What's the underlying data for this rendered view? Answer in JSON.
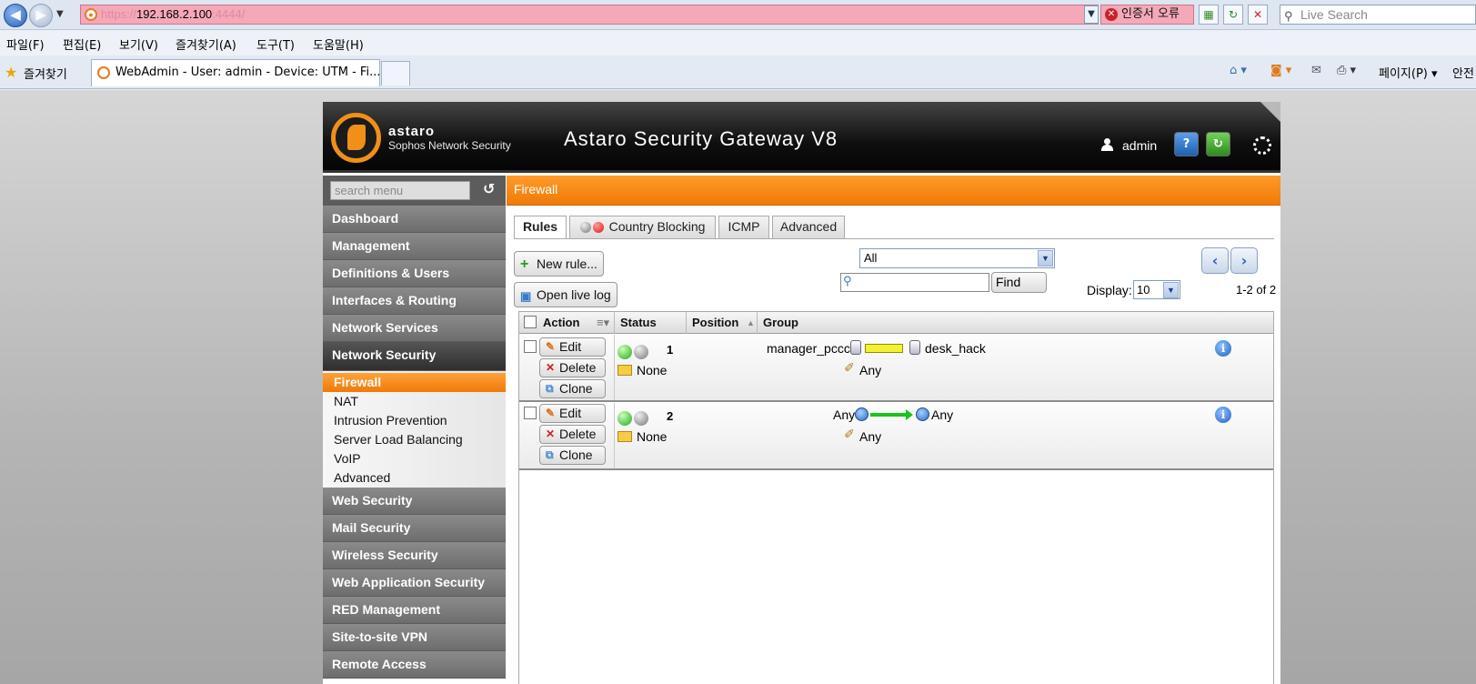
{
  "browser": {
    "url_protocol": "https://",
    "url_host": "192.168.2.100",
    "url_port": ":4444/",
    "cert_error": "인증서 오류",
    "live_search_placeholder": "Live Search",
    "menu": [
      "파일(F)",
      "편집(E)",
      "보기(V)",
      "즐겨찾기(A)",
      "도구(T)",
      "도움말(H)"
    ],
    "favorites_label": "즐겨찾기",
    "tab_title": "WebAdmin - User: admin - Device: UTM - Fi...",
    "page_menu": "페이지(P)",
    "safety_menu": "안전"
  },
  "app": {
    "brand": "astaro",
    "brand_sub": "Sophos Network Security",
    "title": "Astaro Security Gateway V8",
    "user": "admin"
  },
  "sidebar": {
    "search_placeholder": "search menu",
    "sections_top": [
      "Dashboard",
      "Management",
      "Definitions & Users",
      "Interfaces & Routing",
      "Network Services"
    ],
    "active_section": "Network Security",
    "sub_items": [
      "Firewall",
      "NAT",
      "Intrusion Prevention",
      "Server Load Balancing",
      "VoIP",
      "Advanced"
    ],
    "sections_bottom": [
      "Web Security",
      "Mail Security",
      "Wireless Security",
      "Web Application Security",
      "RED Management",
      "Site-to-site VPN",
      "Remote Access"
    ]
  },
  "content": {
    "title": "Firewall",
    "tabs": [
      "Rules",
      "Country Blocking",
      "ICMP",
      "Advanced"
    ],
    "new_rule": "New rule...",
    "open_live_log": "Open live log",
    "filter_value": "All",
    "find": "Find",
    "display_label": "Display:",
    "display_value": "10",
    "count": "1-2 of 2",
    "columns": [
      "Action",
      "Status",
      "Position",
      "Group"
    ],
    "actions": {
      "edit": "Edit",
      "delete": "Delete",
      "clone": "Clone"
    },
    "rules": [
      {
        "position": "1",
        "group": "None",
        "source": "manager_pccc",
        "destination": "desk_hack",
        "service": "Any"
      },
      {
        "position": "2",
        "group": "None",
        "source": "Any",
        "destination": "Any",
        "service": "Any"
      }
    ]
  }
}
